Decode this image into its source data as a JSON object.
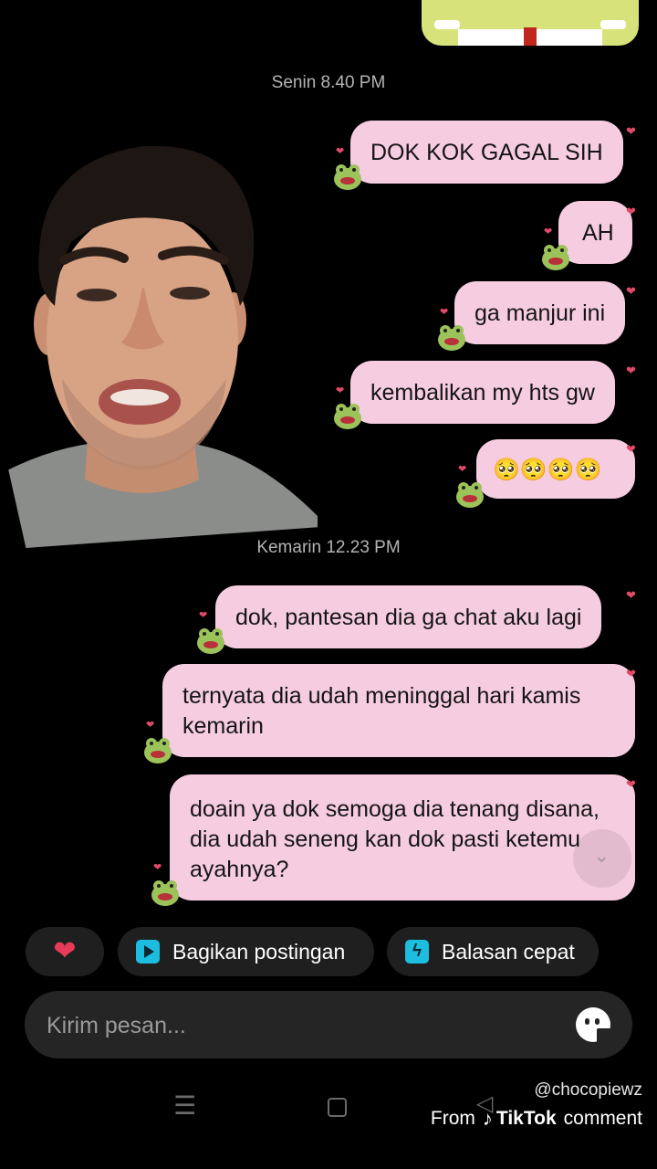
{
  "timestamps": {
    "first": "Senin 8.40 PM",
    "second": "Kemarin 12.23 PM"
  },
  "messages_group_1": [
    {
      "text": "DOK KOK GAGAL SIH"
    },
    {
      "text": "AH"
    },
    {
      "text": "ga manjur ini"
    },
    {
      "text": "kembalikan my hts gw"
    },
    {
      "text": "🥺🥺🥺🥺"
    }
  ],
  "messages_group_2": [
    {
      "text": "dok, pantesan dia ga chat aku lagi"
    },
    {
      "text": "ternyata dia udah meninggal hari kamis kemarin"
    },
    {
      "text": "doain ya dok semoga dia tenang disana, dia udah seneng kan dok pasti ketemu ayahnya?"
    }
  ],
  "actions": {
    "heart": "heart-icon",
    "share_label": "Bagikan postingan",
    "quick_reply_label": "Balasan cepat"
  },
  "composer": {
    "placeholder": "Kirim pesan..."
  },
  "watermark": {
    "handle": "@chocopiewz",
    "from": "From",
    "brand": "TikTok",
    "suffix": "comment"
  },
  "colors": {
    "bubble": "#f6cde0",
    "accent_heart": "#e83a5a",
    "chip_icon": "#1dbde0"
  }
}
